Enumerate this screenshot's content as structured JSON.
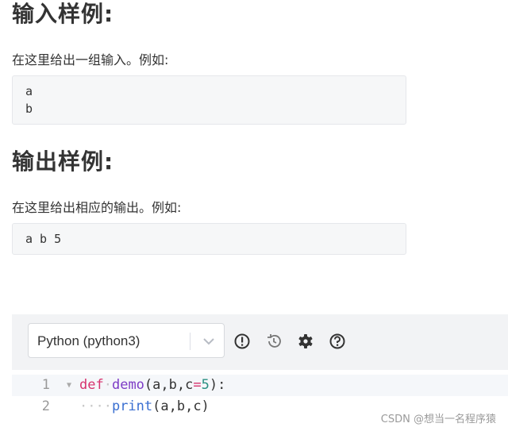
{
  "sections": {
    "input": {
      "heading": "输入样例:",
      "description": "在这里给出一组输入。例如:",
      "sample_lines": [
        "a",
        "b"
      ]
    },
    "output": {
      "heading": "输出样例:",
      "description": "在这里给出相应的输出。例如:",
      "sample_lines": [
        "a b 5"
      ]
    }
  },
  "editor": {
    "language_selected": "Python (python3)",
    "toolbar_icons": [
      "info-icon",
      "history-icon",
      "gear-icon",
      "help-icon"
    ],
    "lines": [
      {
        "number": "1",
        "kw": "def",
        "fn": "demo",
        "open": "(a,b,c",
        "eq": "=",
        "num": "5",
        "close": "):"
      },
      {
        "number": "2",
        "indent": "····",
        "bi": "print",
        "args": "(a,b,c)"
      }
    ]
  },
  "watermark": "CSDN @想当一名程序猿"
}
